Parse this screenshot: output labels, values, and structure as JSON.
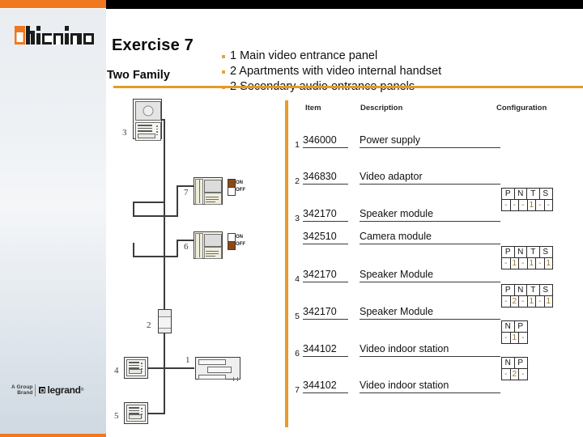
{
  "brand": {
    "logo_text": "bticino",
    "footer_prefix_line1": "A Group",
    "footer_prefix_line2": "Brand",
    "footer_legrand": "legrand",
    "footer_registered": "®",
    "accent_orange": "#f07820",
    "rule_orange": "#e49b26",
    "divider_orange": "#e89b2b",
    "config_value_color": "#9a7b2e"
  },
  "header": {
    "title": "Exercise 7",
    "subtitle": "Two Family",
    "bullets": [
      "1 Main video entrance panel",
      "2 Apartments with video internal handset",
      "2 Secondary audio entrance panels"
    ]
  },
  "table": {
    "columns": {
      "item": "Item",
      "description": "Description",
      "configuration": "Configuration"
    },
    "rows": [
      {
        "num": "1",
        "item": "346000",
        "description": "Power supply",
        "config": null
      },
      {
        "num": "2",
        "item": "346830",
        "description": "Video adaptor",
        "config": null
      },
      {
        "num": "3",
        "item": "342170",
        "description": "Speaker module",
        "config": {
          "headers": [
            "P",
            "N",
            "T",
            "S"
          ],
          "values": [
            "-",
            "-",
            "-",
            "1",
            "-",
            "-"
          ]
        }
      },
      {
        "num": "",
        "item": "342510",
        "description": "Camera module",
        "config": null
      },
      {
        "num": "4",
        "item": "342170",
        "description": "Speaker Module",
        "config": {
          "headers": [
            "P",
            "N",
            "T",
            "S"
          ],
          "values": [
            "-",
            "1",
            "-",
            "1",
            "-",
            "1"
          ]
        }
      },
      {
        "num": "5",
        "item": "342170",
        "description": "Speaker Module",
        "config": {
          "headers": [
            "P",
            "N",
            "T",
            "S"
          ],
          "values": [
            "-",
            "2",
            "-",
            "1",
            "-",
            "1"
          ]
        }
      },
      {
        "num": "6",
        "item": "344102",
        "description": "Video indoor station",
        "config": {
          "headers": [
            "N",
            "P"
          ],
          "values": [
            "-",
            "1",
            "-"
          ]
        }
      },
      {
        "num": "7",
        "item": "344102",
        "description": "Video indoor station",
        "config": {
          "headers": [
            "N",
            "P"
          ],
          "values": [
            "-",
            "2",
            "-"
          ]
        }
      }
    ]
  },
  "diagram": {
    "labels": {
      "main_entrance_panel": "3",
      "handset_top": "7",
      "handset_bottom": "6",
      "video_adaptor": "2",
      "audio_panel_upper": "4",
      "audio_panel_lower": "5",
      "power_supply": "1"
    },
    "switch_legend": {
      "on": "ON",
      "off": "OFF"
    },
    "switch_states": {
      "handset_top": "ON",
      "handset_bottom": "OFF"
    }
  }
}
